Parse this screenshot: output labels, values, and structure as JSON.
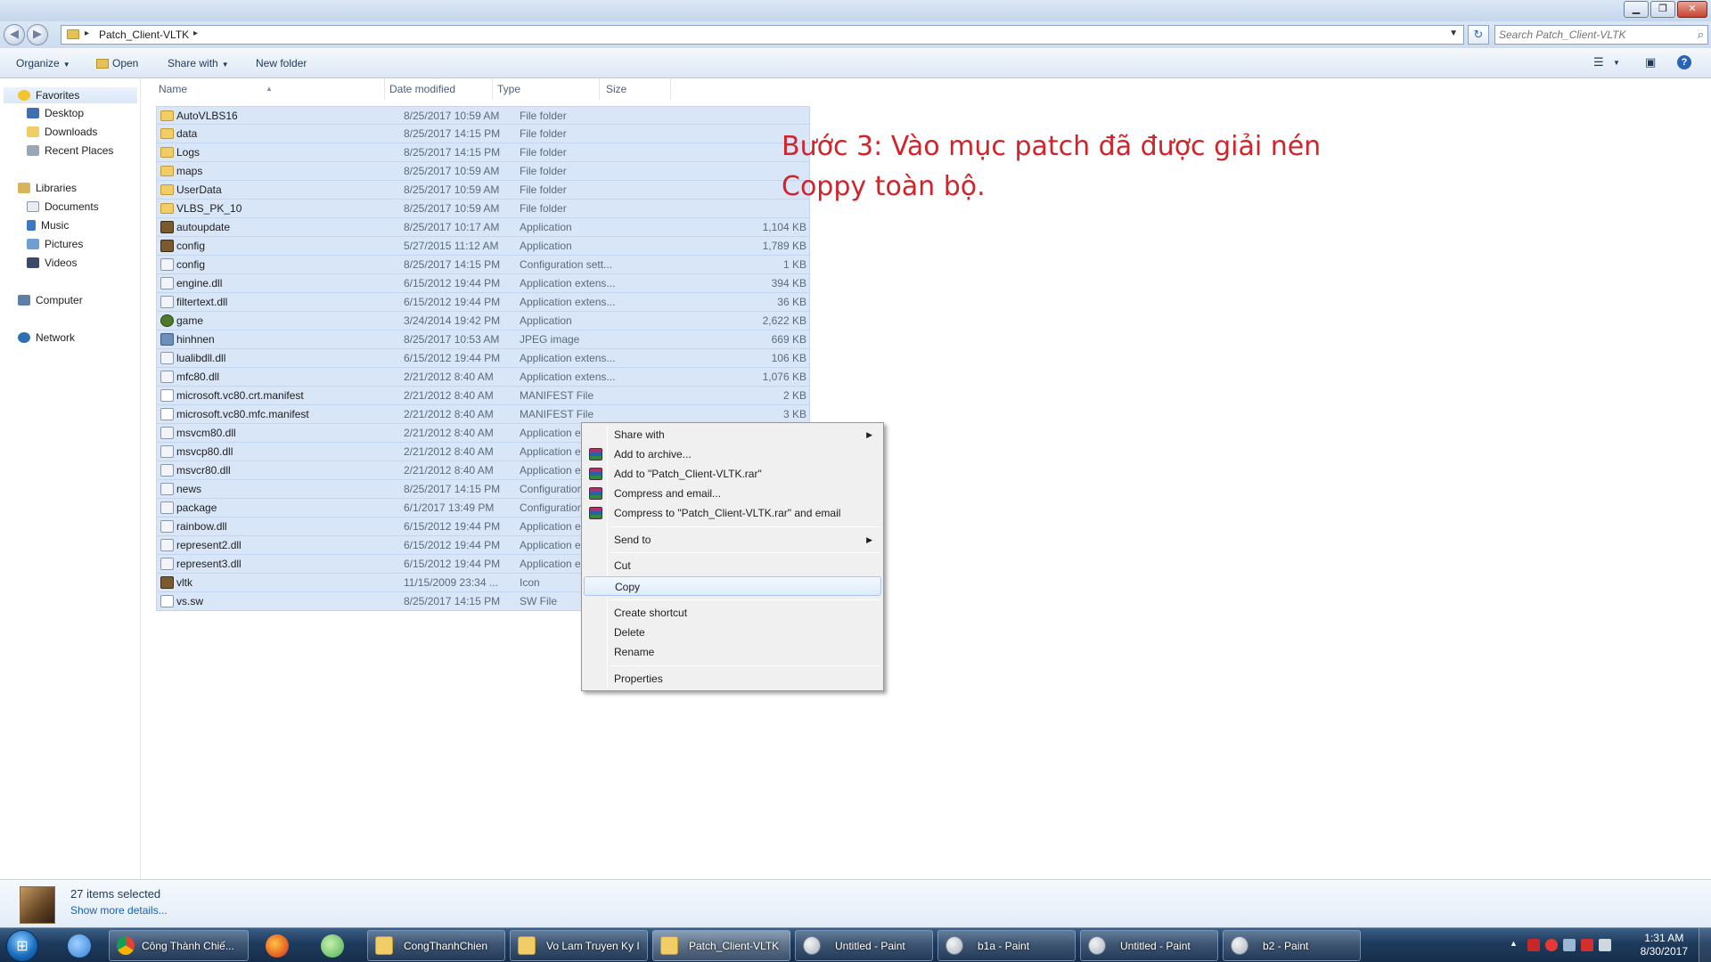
{
  "window": {
    "min_symbol": "▁",
    "max_symbol": "❐",
    "close_symbol": "✕"
  },
  "address": {
    "crumb": "Patch_Client-VLTK",
    "search_placeholder": "Search Patch_Client-VLTK"
  },
  "toolbar": {
    "organize": "Organize",
    "open": "Open",
    "share_with": "Share with",
    "new_folder": "New folder"
  },
  "nav": {
    "favorites": "Favorites",
    "desktop": "Desktop",
    "downloads": "Downloads",
    "recent_places": "Recent Places",
    "libraries": "Libraries",
    "documents": "Documents",
    "music": "Music",
    "pictures": "Pictures",
    "videos": "Videos",
    "computer": "Computer",
    "network": "Network"
  },
  "columns": {
    "name": "Name",
    "date": "Date modified",
    "type": "Type",
    "size": "Size"
  },
  "files": [
    {
      "name": "AutoVLBS16",
      "date": "8/25/2017 10:59 AM",
      "type": "File folder",
      "size": "",
      "icon": "folder"
    },
    {
      "name": "data",
      "date": "8/25/2017 14:15 PM",
      "type": "File folder",
      "size": "",
      "icon": "folder"
    },
    {
      "name": "Logs",
      "date": "8/25/2017 14:15 PM",
      "type": "File folder",
      "size": "",
      "icon": "folder"
    },
    {
      "name": "maps",
      "date": "8/25/2017 10:59 AM",
      "type": "File folder",
      "size": "",
      "icon": "folder"
    },
    {
      "name": "UserData",
      "date": "8/25/2017 10:59 AM",
      "type": "File folder",
      "size": "",
      "icon": "folder"
    },
    {
      "name": "VLBS_PK_10",
      "date": "8/25/2017 10:59 AM",
      "type": "File folder",
      "size": "",
      "icon": "folder"
    },
    {
      "name": "autoupdate",
      "date": "8/25/2017 10:17 AM",
      "type": "Application",
      "size": "1,104 KB",
      "icon": "app"
    },
    {
      "name": "config",
      "date": "5/27/2015 11:12 AM",
      "type": "Application",
      "size": "1,789 KB",
      "icon": "app"
    },
    {
      "name": "config",
      "date": "8/25/2017 14:15 PM",
      "type": "Configuration sett...",
      "size": "1 KB",
      "icon": "dll"
    },
    {
      "name": "engine.dll",
      "date": "6/15/2012 19:44 PM",
      "type": "Application extens...",
      "size": "394 KB",
      "icon": "dll"
    },
    {
      "name": "filtertext.dll",
      "date": "6/15/2012 19:44 PM",
      "type": "Application extens...",
      "size": "36 KB",
      "icon": "dll"
    },
    {
      "name": "game",
      "date": "3/24/2014 19:42 PM",
      "type": "Application",
      "size": "2,622 KB",
      "icon": "game"
    },
    {
      "name": "hinhnen",
      "date": "8/25/2017 10:53 AM",
      "type": "JPEG image",
      "size": "669 KB",
      "icon": "img"
    },
    {
      "name": "lualibdll.dll",
      "date": "6/15/2012 19:44 PM",
      "type": "Application extens...",
      "size": "106 KB",
      "icon": "dll"
    },
    {
      "name": "mfc80.dll",
      "date": "2/21/2012 8:40 AM",
      "type": "Application extens...",
      "size": "1,076 KB",
      "icon": "dll"
    },
    {
      "name": "microsoft.vc80.crt.manifest",
      "date": "2/21/2012 8:40 AM",
      "type": "MANIFEST File",
      "size": "2 KB",
      "icon": "doc"
    },
    {
      "name": "microsoft.vc80.mfc.manifest",
      "date": "2/21/2012 8:40 AM",
      "type": "MANIFEST File",
      "size": "3 KB",
      "icon": "doc"
    },
    {
      "name": "msvcm80.dll",
      "date": "2/21/2012 8:40 AM",
      "type": "Application extens",
      "size": "",
      "icon": "dll"
    },
    {
      "name": "msvcp80.dll",
      "date": "2/21/2012 8:40 AM",
      "type": "Application extens",
      "size": "",
      "icon": "dll"
    },
    {
      "name": "msvcr80.dll",
      "date": "2/21/2012 8:40 AM",
      "type": "Application extens",
      "size": "",
      "icon": "dll"
    },
    {
      "name": "news",
      "date": "8/25/2017 14:15 PM",
      "type": "Configuration sett",
      "size": "",
      "icon": "dll"
    },
    {
      "name": "package",
      "date": "6/1/2017 13:49 PM",
      "type": "Configuration sett",
      "size": "",
      "icon": "dll"
    },
    {
      "name": "rainbow.dll",
      "date": "6/15/2012 19:44 PM",
      "type": "Application extens",
      "size": "",
      "icon": "dll"
    },
    {
      "name": "represent2.dll",
      "date": "6/15/2012 19:44 PM",
      "type": "Application extens",
      "size": "",
      "icon": "dll"
    },
    {
      "name": "represent3.dll",
      "date": "6/15/2012 19:44 PM",
      "type": "Application extens",
      "size": "",
      "icon": "dll"
    },
    {
      "name": "vltk",
      "date": "11/15/2009 23:34 ...",
      "type": "Icon",
      "size": "",
      "icon": "app"
    },
    {
      "name": "vs.sw",
      "date": "8/25/2017 14:15 PM",
      "type": "SW File",
      "size": "",
      "icon": "doc"
    }
  ],
  "annotation": {
    "line1": "Bước 3: Vào mục patch đã được giải nén",
    "line2": "Coppy toàn bộ."
  },
  "context_menu": {
    "share_with": "Share with",
    "add_archive": "Add to archive...",
    "add_rar": "Add to \"Patch_Client-VLTK.rar\"",
    "compress_email": "Compress and email...",
    "compress_rar_email": "Compress to \"Patch_Client-VLTK.rar\" and email",
    "send_to": "Send to",
    "cut": "Cut",
    "copy": "Copy",
    "create_shortcut": "Create shortcut",
    "delete": "Delete",
    "rename": "Rename",
    "properties": "Properties",
    "highlighted": "copy"
  },
  "details": {
    "count": "27 items selected",
    "more": "Show more details..."
  },
  "taskbar": {
    "start_glyph": "⊞",
    "chrome": "Công Thành Chiế...",
    "folder1": "CongThanhChien",
    "folder2": "Vo Lam Truyen Ky I",
    "folder3": "Patch_Client-VLTK",
    "paint1": "Untitled - Paint",
    "paint2": "b1a - Paint",
    "paint3": "Untitled - Paint",
    "paint4": "b2 - Paint",
    "time": "1:31 AM",
    "date": "8/30/2017",
    "colors": {
      "ie": "#2f7fd6",
      "firefox": "#e8661f",
      "coccoc": "#4caf50"
    }
  }
}
